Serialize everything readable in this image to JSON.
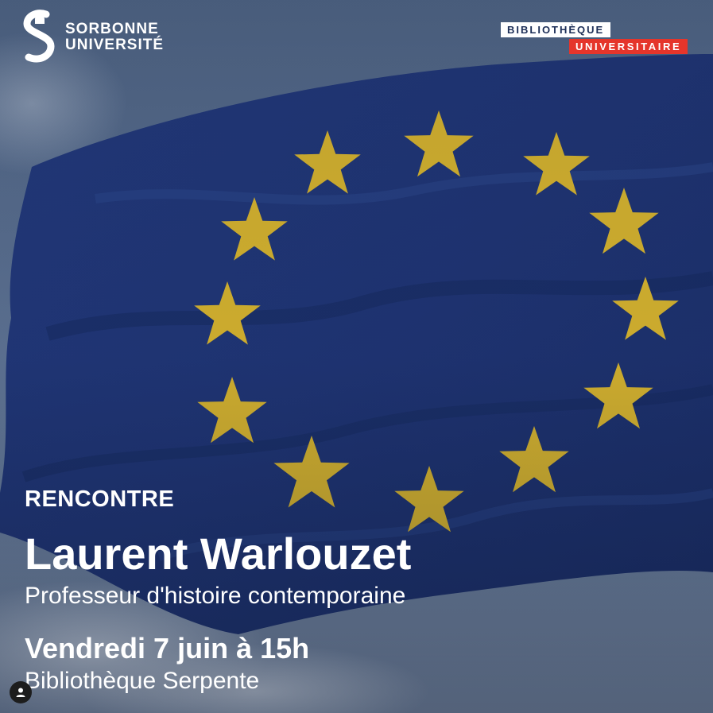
{
  "logos": {
    "sorbonne": {
      "line1": "SORBONNE",
      "line2": "UNIVERSITÉ"
    },
    "bibliotheque": {
      "top": "BIBLIOTHÈQUE",
      "bottom": "UNIVERSITAIRE"
    }
  },
  "event": {
    "type": "RENCONTRE",
    "speaker": "Laurent Warlouzet",
    "title": "Professeur d'histoire contemporaine",
    "date": "Vendredi 7 juin à 15h",
    "location": "Bibliothèque Serpente"
  },
  "colors": {
    "flag_blue": "#21387a",
    "star_gold": "#d6b32e",
    "sky": "#5c7192",
    "brand_red": "#e5352b",
    "brand_navy": "#1c2e57",
    "text": "#ffffff"
  },
  "icons": [
    "sorbonne-emblem-icon",
    "user-profile-icon"
  ]
}
